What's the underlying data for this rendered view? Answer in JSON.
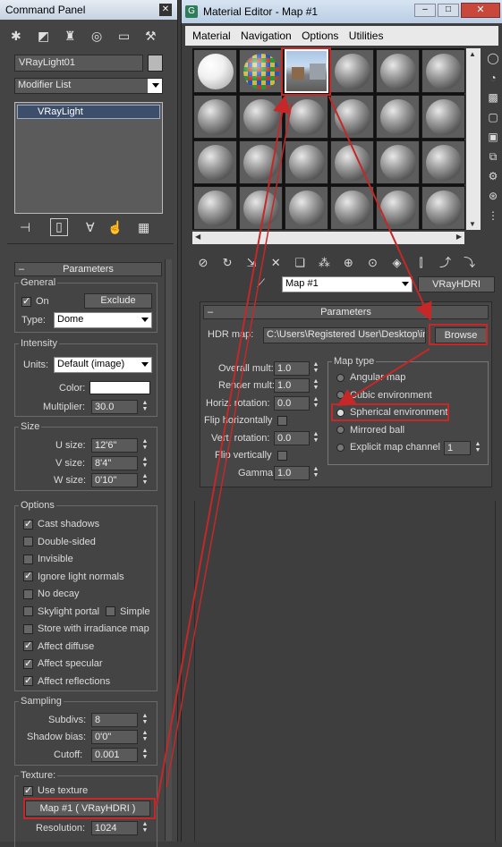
{
  "command_panel": {
    "title": "Command Panel",
    "object_name": "VRayLight01",
    "modifier_list": "Modifier List",
    "stack_item": "VRayLight",
    "rollout_title": "Parameters",
    "general": {
      "label": "General",
      "on_label": "On",
      "on_checked": true,
      "exclude_button": "Exclude",
      "type_label": "Type:",
      "type_value": "Dome"
    },
    "intensity": {
      "label": "Intensity",
      "units_label": "Units:",
      "units_value": "Default (image)",
      "color_label": "Color:",
      "multiplier_label": "Multiplier:",
      "multiplier_value": "30.0"
    },
    "size": {
      "label": "Size",
      "u_label": "U size:",
      "u_value": "12'6\"",
      "v_label": "V size:",
      "v_value": "8'4\"",
      "w_label": "W size:",
      "w_value": "0'10\""
    },
    "options": {
      "label": "Options",
      "items": [
        {
          "label": "Cast shadows",
          "checked": true
        },
        {
          "label": "Double-sided",
          "checked": false
        },
        {
          "label": "Invisible",
          "checked": false
        },
        {
          "label": "Ignore light normals",
          "checked": true
        },
        {
          "label": "No decay",
          "checked": false
        },
        {
          "label": "Skylight portal",
          "checked": false
        },
        {
          "label": "Store with irradiance map",
          "checked": false
        },
        {
          "label": "Affect diffuse",
          "checked": true
        },
        {
          "label": "Affect specular",
          "checked": true
        },
        {
          "label": "Affect reflections",
          "checked": true
        }
      ],
      "simple_label": "Simple"
    },
    "sampling": {
      "label": "Sampling",
      "subdivs_label": "Subdivs:",
      "subdivs_value": "8",
      "shadow_bias_label": "Shadow bias:",
      "shadow_bias_value": "0'0\"",
      "cutoff_label": "Cutoff:",
      "cutoff_value": "0.001"
    },
    "texture": {
      "label": "Texture:",
      "use_texture_label": "Use texture",
      "use_texture_checked": true,
      "map_button": "Map #1  ( VRayHDRI )",
      "resolution_label": "Resolution:",
      "resolution_value": "1024"
    }
  },
  "material_editor": {
    "title": "Material Editor - Map #1",
    "menu": [
      "Material",
      "Navigation",
      "Options",
      "Utilities"
    ],
    "map_name": "Map #1",
    "map_type": "VRayHDRI",
    "rollout_title": "Parameters",
    "hdr_map_label": "HDR map:",
    "hdr_map_path": "C:\\Users\\Registered User\\Desktop\\in",
    "browse_button": "Browse",
    "overall_mult_label": "Overall mult:",
    "overall_mult_value": "1.0",
    "render_mult_label": "Render mult:",
    "render_mult_value": "1.0",
    "horiz_rotation_label": "Horiz. rotation:",
    "horiz_rotation_value": "0.0",
    "flip_horizontally_label": "Flip horizontally",
    "vert_rotation_label": "Vert. rotation:",
    "vert_rotation_value": "0.0",
    "flip_vertically_label": "Flip vertically",
    "gamma_label": "Gamma:",
    "gamma_value": "1.0",
    "map_type_group": "Map type",
    "map_types": [
      {
        "label": "Angular map",
        "selected": false
      },
      {
        "label": "Cubic environment",
        "selected": false
      },
      {
        "label": "Spherical environment",
        "selected": true
      },
      {
        "label": "Mirrored ball",
        "selected": false
      },
      {
        "label": "Explicit map channel",
        "selected": false
      }
    ],
    "map_channel_value": "1"
  },
  "colors": {
    "annotation_red": "#c62828"
  }
}
